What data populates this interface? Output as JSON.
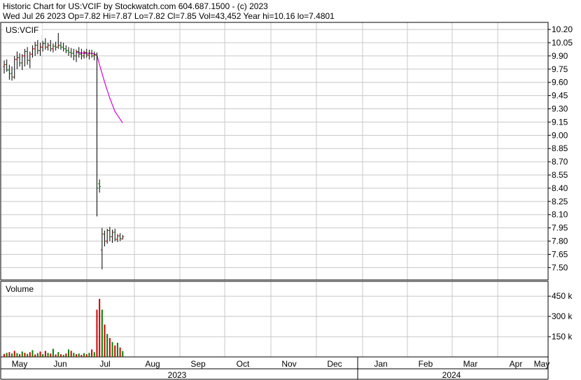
{
  "header": {
    "line1": "Historic Chart for US:VCIF by Stockwatch.com 604.687.1500 - (c) 2023",
    "line2": "Wed Jul 26 2023  Op=7.82  Hi=7.87  Lo=7.82  Cl=7.85  Vol=43,452  Year hi=10.16  lo=7.4801"
  },
  "chart_data": [
    {
      "type": "ohlc",
      "title": "US:VCIF",
      "y_ticks": [
        "10.20",
        "10.05",
        "9.90",
        "9.75",
        "9.60",
        "9.45",
        "9.30",
        "9.15",
        "9.00",
        "8.85",
        "8.70",
        "8.55",
        "8.40",
        "8.25",
        "8.10",
        "7.95",
        "7.80",
        "7.65",
        "7.50"
      ],
      "ylim": [
        7.36,
        10.28
      ],
      "grid": true,
      "colors": {
        "up": "#cc0000",
        "down": "#008000",
        "neutral": "#000000",
        "ma": "#dd00dd"
      },
      "bars": [
        {
          "d": 0,
          "o": 9.78,
          "h": 9.85,
          "l": 9.7,
          "c": 9.8
        },
        {
          "d": 1,
          "o": 9.8,
          "h": 9.86,
          "l": 9.72,
          "c": 9.74
        },
        {
          "d": 2,
          "o": 9.74,
          "h": 9.8,
          "l": 9.63,
          "c": 9.7
        },
        {
          "d": 3,
          "o": 9.7,
          "h": 9.78,
          "l": 9.62,
          "c": 9.66
        },
        {
          "d": 4,
          "o": 9.66,
          "h": 9.9,
          "l": 9.64,
          "c": 9.86
        },
        {
          "d": 5,
          "o": 9.86,
          "h": 9.95,
          "l": 9.75,
          "c": 9.88
        },
        {
          "d": 6,
          "o": 9.88,
          "h": 9.93,
          "l": 9.78,
          "c": 9.82
        },
        {
          "d": 7,
          "o": 9.82,
          "h": 9.92,
          "l": 9.74,
          "c": 9.9
        },
        {
          "d": 8,
          "o": 9.9,
          "h": 9.98,
          "l": 9.78,
          "c": 9.95
        },
        {
          "d": 9,
          "o": 9.95,
          "h": 10.0,
          "l": 9.8,
          "c": 9.85
        },
        {
          "d": 10,
          "o": 9.85,
          "h": 9.95,
          "l": 9.76,
          "c": 9.92
        },
        {
          "d": 11,
          "o": 9.92,
          "h": 10.02,
          "l": 9.88,
          "c": 9.98
        },
        {
          "d": 12,
          "o": 9.98,
          "h": 10.06,
          "l": 9.9,
          "c": 10.02
        },
        {
          "d": 13,
          "o": 10.02,
          "h": 10.08,
          "l": 9.92,
          "c": 9.96
        },
        {
          "d": 14,
          "o": 9.96,
          "h": 10.05,
          "l": 9.9,
          "c": 10.0
        },
        {
          "d": 15,
          "o": 10.0,
          "h": 10.07,
          "l": 9.95,
          "c": 10.04
        },
        {
          "d": 16,
          "o": 10.04,
          "h": 10.1,
          "l": 9.97,
          "c": 10.0
        },
        {
          "d": 17,
          "o": 10.0,
          "h": 10.05,
          "l": 9.96,
          "c": 10.02
        },
        {
          "d": 18,
          "o": 10.02,
          "h": 10.08,
          "l": 9.95,
          "c": 9.98
        },
        {
          "d": 19,
          "o": 9.98,
          "h": 10.04,
          "l": 9.94,
          "c": 10.01
        },
        {
          "d": 20,
          "o": 10.01,
          "h": 10.06,
          "l": 9.96,
          "c": 10.0
        },
        {
          "d": 21,
          "o": 10.0,
          "h": 10.16,
          "l": 9.98,
          "c": 10.02
        },
        {
          "d": 22,
          "o": 10.02,
          "h": 10.06,
          "l": 9.97,
          "c": 10.0
        },
        {
          "d": 23,
          "o": 10.0,
          "h": 10.05,
          "l": 9.95,
          "c": 9.98
        },
        {
          "d": 24,
          "o": 9.98,
          "h": 10.02,
          "l": 9.93,
          "c": 9.96
        },
        {
          "d": 25,
          "o": 9.96,
          "h": 10.0,
          "l": 9.9,
          "c": 9.94
        },
        {
          "d": 26,
          "o": 9.94,
          "h": 9.99,
          "l": 9.88,
          "c": 9.93
        },
        {
          "d": 27,
          "o": 9.93,
          "h": 9.98,
          "l": 9.85,
          "c": 9.9
        },
        {
          "d": 28,
          "o": 9.9,
          "h": 9.97,
          "l": 9.83,
          "c": 9.95
        },
        {
          "d": 29,
          "o": 9.95,
          "h": 10.0,
          "l": 9.88,
          "c": 9.92
        },
        {
          "d": 30,
          "o": 9.92,
          "h": 9.98,
          "l": 9.86,
          "c": 9.9
        },
        {
          "d": 31,
          "o": 9.9,
          "h": 9.96,
          "l": 9.87,
          "c": 9.94
        },
        {
          "d": 32,
          "o": 9.94,
          "h": 9.98,
          "l": 9.88,
          "c": 9.91
        },
        {
          "d": 33,
          "o": 9.91,
          "h": 9.97,
          "l": 9.86,
          "c": 9.93
        },
        {
          "d": 34,
          "o": 9.93,
          "h": 9.97,
          "l": 9.88,
          "c": 9.9
        },
        {
          "d": 35,
          "o": 9.9,
          "h": 9.95,
          "l": 9.85,
          "c": 9.91
        },
        {
          "d": 36,
          "o": 9.91,
          "h": 9.94,
          "l": 8.08,
          "c": 8.4
        },
        {
          "d": 37,
          "o": 8.45,
          "h": 8.5,
          "l": 8.35,
          "c": 8.42
        },
        {
          "d": 38,
          "o": 7.7,
          "h": 7.95,
          "l": 7.48,
          "c": 7.88
        },
        {
          "d": 39,
          "o": 7.88,
          "h": 7.92,
          "l": 7.74,
          "c": 7.8
        },
        {
          "d": 40,
          "o": 7.8,
          "h": 7.94,
          "l": 7.77,
          "c": 7.92
        },
        {
          "d": 41,
          "o": 7.92,
          "h": 7.96,
          "l": 7.8,
          "c": 7.85
        },
        {
          "d": 42,
          "o": 7.85,
          "h": 7.93,
          "l": 7.78,
          "c": 7.9
        },
        {
          "d": 43,
          "o": 7.9,
          "h": 7.94,
          "l": 7.8,
          "c": 7.82
        },
        {
          "d": 44,
          "o": 7.82,
          "h": 7.88,
          "l": 7.79,
          "c": 7.86
        },
        {
          "d": 45,
          "o": 7.86,
          "h": 7.89,
          "l": 7.8,
          "c": 7.83
        },
        {
          "d": 46,
          "o": 7.82,
          "h": 7.87,
          "l": 7.82,
          "c": 7.85
        }
      ],
      "moving_average": [
        {
          "d": 28,
          "v": 9.94
        },
        {
          "d": 31,
          "v": 9.93
        },
        {
          "d": 34,
          "v": 9.93
        },
        {
          "d": 36,
          "v": 9.91
        },
        {
          "d": 37,
          "v": 9.8
        },
        {
          "d": 39,
          "v": 9.6
        },
        {
          "d": 41,
          "v": 9.42
        },
        {
          "d": 43,
          "v": 9.27
        },
        {
          "d": 46,
          "v": 9.14
        }
      ]
    },
    {
      "type": "bar",
      "title": "Volume",
      "y_ticks": [
        "450 k",
        "300 k",
        "150 k"
      ],
      "y_tick_values": [
        450000,
        300000,
        150000
      ],
      "ylim": [
        0,
        560000
      ],
      "volumes": [
        {
          "d": 0,
          "v": 22000,
          "dir": "up"
        },
        {
          "d": 1,
          "v": 30000,
          "dir": "down"
        },
        {
          "d": 2,
          "v": 35000,
          "dir": "up"
        },
        {
          "d": 3,
          "v": 25000,
          "dir": "down"
        },
        {
          "d": 4,
          "v": 45000,
          "dir": "up"
        },
        {
          "d": 5,
          "v": 28000,
          "dir": "down"
        },
        {
          "d": 6,
          "v": 20000,
          "dir": "up"
        },
        {
          "d": 7,
          "v": 40000,
          "dir": "down"
        },
        {
          "d": 8,
          "v": 30000,
          "dir": "up"
        },
        {
          "d": 9,
          "v": 22000,
          "dir": "down"
        },
        {
          "d": 10,
          "v": 35000,
          "dir": "up"
        },
        {
          "d": 11,
          "v": 50000,
          "dir": "down"
        },
        {
          "d": 12,
          "v": 18000,
          "dir": "up"
        },
        {
          "d": 13,
          "v": 28000,
          "dir": "down"
        },
        {
          "d": 14,
          "v": 40000,
          "dir": "up"
        },
        {
          "d": 15,
          "v": 20000,
          "dir": "down"
        },
        {
          "d": 16,
          "v": 45000,
          "dir": "up"
        },
        {
          "d": 17,
          "v": 30000,
          "dir": "down"
        },
        {
          "d": 18,
          "v": 25000,
          "dir": "up"
        },
        {
          "d": 19,
          "v": 60000,
          "dir": "down"
        },
        {
          "d": 20,
          "v": 18000,
          "dir": "up"
        },
        {
          "d": 21,
          "v": 35000,
          "dir": "down"
        },
        {
          "d": 22,
          "v": 20000,
          "dir": "up"
        },
        {
          "d": 23,
          "v": 15000,
          "dir": "down"
        },
        {
          "d": 24,
          "v": 25000,
          "dir": "up"
        },
        {
          "d": 25,
          "v": 55000,
          "dir": "down"
        },
        {
          "d": 26,
          "v": 45000,
          "dir": "up"
        },
        {
          "d": 27,
          "v": 30000,
          "dir": "down"
        },
        {
          "d": 28,
          "v": 20000,
          "dir": "up"
        },
        {
          "d": 29,
          "v": 25000,
          "dir": "down"
        },
        {
          "d": 30,
          "v": 15000,
          "dir": "up"
        },
        {
          "d": 31,
          "v": 28000,
          "dir": "down"
        },
        {
          "d": 32,
          "v": 20000,
          "dir": "up"
        },
        {
          "d": 33,
          "v": 30000,
          "dir": "down"
        },
        {
          "d": 34,
          "v": 55000,
          "dir": "up"
        },
        {
          "d": 35,
          "v": 35000,
          "dir": "down"
        },
        {
          "d": 36,
          "v": 350000,
          "dir": "up"
        },
        {
          "d": 37,
          "v": 430000,
          "dir": "up"
        },
        {
          "d": 38,
          "v": 350000,
          "dir": "down"
        },
        {
          "d": 39,
          "v": 240000,
          "dir": "up"
        },
        {
          "d": 40,
          "v": 170000,
          "dir": "down"
        },
        {
          "d": 41,
          "v": 140000,
          "dir": "up"
        },
        {
          "d": 42,
          "v": 110000,
          "dir": "down"
        },
        {
          "d": 43,
          "v": 85000,
          "dir": "up"
        },
        {
          "d": 44,
          "v": 105000,
          "dir": "down"
        },
        {
          "d": 45,
          "v": 70000,
          "dir": "up"
        },
        {
          "d": 46,
          "v": 43452,
          "dir": "down"
        }
      ]
    }
  ],
  "x_axis": {
    "months": [
      "May",
      "Jun",
      "Jul",
      "Aug",
      "Sep",
      "Oct",
      "Nov",
      "Dec",
      "Jan",
      "Feb",
      "Mar",
      "Apr",
      "May"
    ],
    "years": [
      "2023",
      "2024"
    ]
  }
}
